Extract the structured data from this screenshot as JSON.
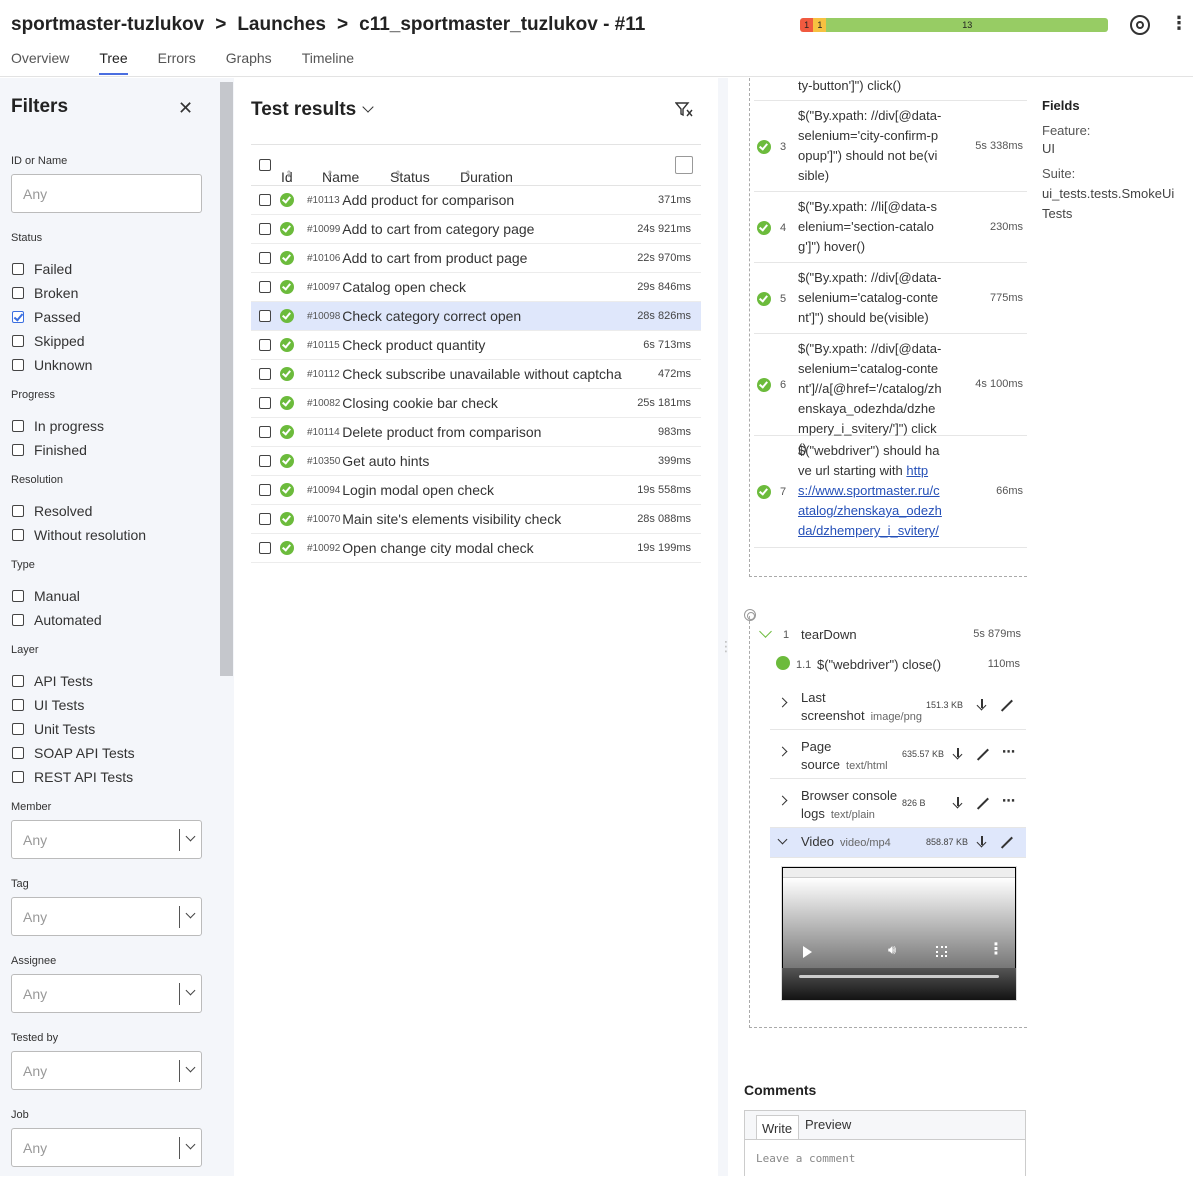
{
  "header": {
    "crumbs": [
      "sportmaster-tuzlukov",
      "Launches",
      "c11_sportmaster_tuzlukov - #11"
    ],
    "separator": ">",
    "status_counts": [
      {
        "label": "1",
        "color": "#f05a3f",
        "fraction": 0.043
      },
      {
        "label": "1",
        "color": "#f7c141",
        "fraction": 0.043
      },
      {
        "label": "13",
        "color": "#97cc64",
        "fraction": 0.914
      }
    ],
    "tabs": [
      "Overview",
      "Tree",
      "Errors",
      "Graphs",
      "Timeline"
    ],
    "active_tab": "Tree"
  },
  "filters": {
    "title": "Filters",
    "id_label": "ID or Name",
    "placeholder": "Any",
    "status_label": "Status",
    "status": [
      {
        "label": "Failed",
        "checked": false
      },
      {
        "label": "Broken",
        "checked": false
      },
      {
        "label": "Passed",
        "checked": true
      },
      {
        "label": "Skipped",
        "checked": false
      },
      {
        "label": "Unknown",
        "checked": false
      }
    ],
    "progress_label": "Progress",
    "progress": [
      "In progress",
      "Finished"
    ],
    "resolution_label": "Resolution",
    "resolution": [
      "Resolved",
      "Without resolution"
    ],
    "type_label": "Type",
    "type": [
      "Manual",
      "Automated"
    ],
    "layer_label": "Layer",
    "layer": [
      "API Tests",
      "UI Tests",
      "Unit Tests",
      "SOAP API Tests",
      "REST API Tests"
    ],
    "member_label": "Member",
    "tag_label": "Tag",
    "assignee_label": "Assignee",
    "tested_by_label": "Tested by",
    "job_label": "Job"
  },
  "results": {
    "title": "Test results",
    "columns": [
      "Id",
      "Name",
      "Status",
      "Duration"
    ],
    "rows": [
      {
        "id": "#10113",
        "name": "Add product for comparison",
        "duration": "371ms",
        "selected": false
      },
      {
        "id": "#10099",
        "name": "Add to cart from category page",
        "duration": "24s 921ms",
        "selected": false
      },
      {
        "id": "#10106",
        "name": "Add to cart from product page",
        "duration": "22s 970ms",
        "selected": false
      },
      {
        "id": "#10097",
        "name": "Catalog open check",
        "duration": "29s 846ms",
        "selected": false
      },
      {
        "id": "#10098",
        "name": "Check category correct open",
        "duration": "28s 826ms",
        "selected": true
      },
      {
        "id": "#10115",
        "name": "Check product quantity",
        "duration": "6s 713ms",
        "selected": false
      },
      {
        "id": "#10112",
        "name": "Check subscribe unavailable without captcha",
        "duration": "472ms",
        "selected": false
      },
      {
        "id": "#10082",
        "name": "Closing cookie bar check",
        "duration": "25s 181ms",
        "selected": false
      },
      {
        "id": "#10114",
        "name": "Delete product from comparison",
        "duration": "983ms",
        "selected": false
      },
      {
        "id": "#10350",
        "name": "Get auto hints",
        "duration": "399ms",
        "selected": false
      },
      {
        "id": "#10094",
        "name": "Login modal open check",
        "duration": "19s 558ms",
        "selected": false
      },
      {
        "id": "#10070",
        "name": "Main site's elements visibility check",
        "duration": "28s 088ms",
        "selected": false
      },
      {
        "id": "#10092",
        "name": "Open change city modal check",
        "duration": "19s 199ms",
        "selected": false
      }
    ]
  },
  "steps": {
    "partial_top": "ty-button']\") click()",
    "items": [
      {
        "num": "3",
        "text": "$(\"By.xpath: //div[@data-selenium='city-confirm-popup']\") should not be(visible)",
        "duration": "5s 338ms"
      },
      {
        "num": "4",
        "text": "$(\"By.xpath: //li[@data-selenium='section-catalog']\") hover()",
        "duration": "230ms"
      },
      {
        "num": "5",
        "text": "$(\"By.xpath: //div[@data-selenium='catalog-content']\") should be(visible)",
        "duration": "775ms"
      },
      {
        "num": "6",
        "text": "$(\"By.xpath: //div[@data-selenium='catalog-content']//a[@href='/catalog/zhenskaya_odezhda/dzhempery_i_svitery/']\") click()",
        "duration": "4s 100ms"
      },
      {
        "num": "7",
        "text": "$(\"webdriver\") should have url starting with ",
        "link": "https://www.sportmaster.ru/catalog/zhenskaya_odezhda/dzhempery_i_svitery/",
        "duration": "66ms"
      }
    ],
    "teardown": {
      "num": "1",
      "label": "tearDown",
      "duration": "5s 879ms"
    },
    "close_step": {
      "num": "1.1",
      "text": "$(\"webdriver\") close()",
      "duration": "110ms"
    },
    "attachments": [
      {
        "name": "Last screenshot",
        "mime": "image/png",
        "size": "151.3 KB",
        "more": false,
        "open": false
      },
      {
        "name": "Page source",
        "mime": "text/html",
        "size": "635.57 KB",
        "more": true,
        "open": false
      },
      {
        "name": "Browser console logs",
        "mime": "text/plain",
        "size": "826 B",
        "more": true,
        "open": false
      },
      {
        "name": "Video",
        "mime": "video/mp4",
        "size": "858.87 KB",
        "more": false,
        "open": true
      }
    ]
  },
  "fields": {
    "title": "Fields",
    "feature_label": "Feature:",
    "feature_value": "UI",
    "suite_label": "Suite:",
    "suite_value": "ui_tests.tests.SmokeUiTests"
  },
  "comments": {
    "title": "Comments",
    "write_tab": "Write",
    "preview_tab": "Preview",
    "placeholder": "Leave a comment"
  }
}
